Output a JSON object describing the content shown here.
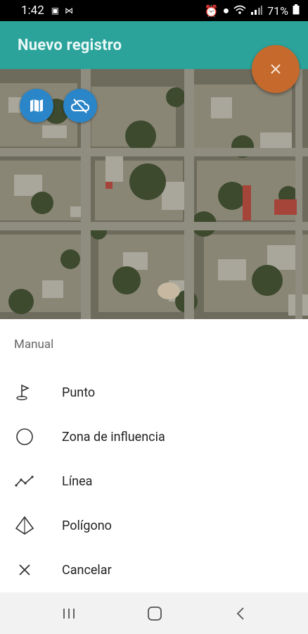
{
  "status_bar": {
    "time": "1:42",
    "battery": "71%"
  },
  "app_bar": {
    "title": "Nuevo registro"
  },
  "sheet": {
    "section_title": "Manual",
    "items": [
      {
        "label": "Punto",
        "icon": "flag-point-icon"
      },
      {
        "label": "Zona de influencia",
        "icon": "circle-icon"
      },
      {
        "label": "Línea",
        "icon": "polyline-icon"
      },
      {
        "label": "Polígono",
        "icon": "polygon-icon"
      },
      {
        "label": "Cancelar",
        "icon": "close-icon"
      }
    ]
  },
  "colors": {
    "primary": "#2ba39b",
    "accent": "#c56a2c",
    "map_button": "#2a86c8"
  }
}
